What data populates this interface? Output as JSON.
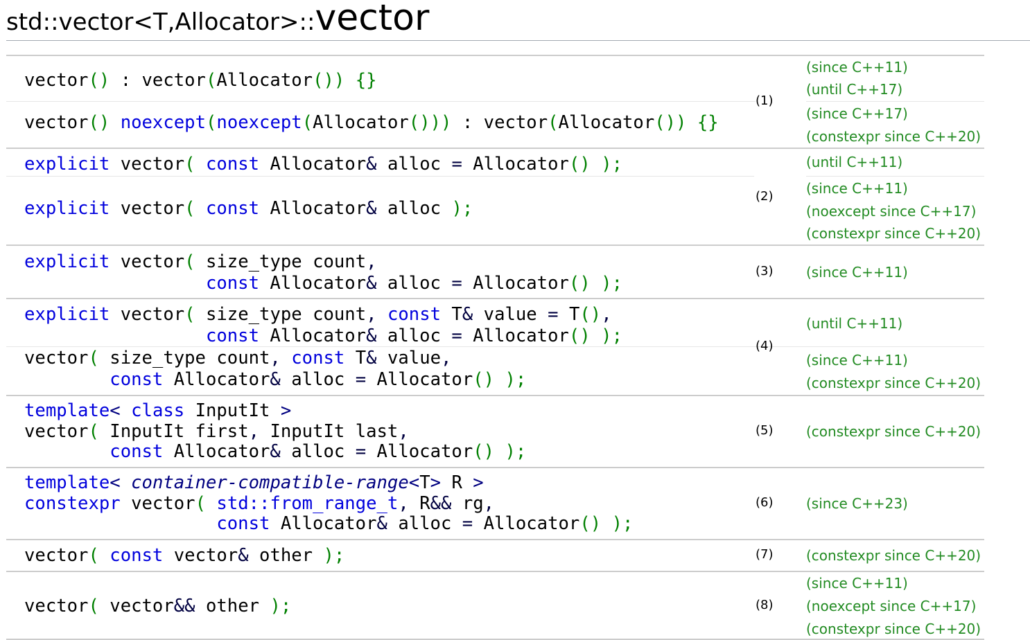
{
  "title": {
    "prefix": "std::vector<T,Allocator>::",
    "main": "vector"
  },
  "overloads": [
    {
      "number": "(1)",
      "variants": [
        {
          "code": [
            [
              [
                "vector",
                "co"
              ],
              [
                "()",
                "p"
              ],
              [
                " : ",
                "co"
              ],
              [
                "vector",
                "co"
              ],
              [
                "(",
                "p"
              ],
              [
                "Allocator",
                "co"
              ],
              [
                "())",
                "p"
              ],
              [
                " ",
                "co"
              ],
              [
                "{}",
                "p"
              ]
            ]
          ],
          "versions": [
            "(since C++11)",
            "(until C++17)"
          ]
        },
        {
          "code": [
            [
              [
                "vector",
                "co"
              ],
              [
                "()",
                "p"
              ],
              [
                " ",
                "co"
              ],
              [
                "noexcept",
                "kw"
              ],
              [
                "(",
                "p"
              ],
              [
                "noexcept",
                "kw"
              ],
              [
                "(",
                "p"
              ],
              [
                "Allocator",
                "co"
              ],
              [
                "()))",
                "p"
              ],
              [
                " : ",
                "co"
              ],
              [
                "vector",
                "co"
              ],
              [
                "(",
                "p"
              ],
              [
                "Allocator",
                "co"
              ],
              [
                "())",
                "p"
              ],
              [
                " ",
                "co"
              ],
              [
                "{}",
                "p"
              ]
            ]
          ],
          "versions": [
            "(since C++17)",
            "(constexpr since C++20)"
          ]
        }
      ]
    },
    {
      "number": "(2)",
      "variants": [
        {
          "code": [
            [
              [
                "explicit",
                "kw"
              ],
              [
                " vector",
                "co"
              ],
              [
                "(",
                "p"
              ],
              [
                " ",
                "co"
              ],
              [
                "const",
                "kw"
              ],
              [
                " Allocator",
                "co"
              ],
              [
                "&",
                "op"
              ],
              [
                " alloc ",
                "co"
              ],
              [
                "=",
                "op"
              ],
              [
                " Allocator",
                "co"
              ],
              [
                "()",
                "p"
              ],
              [
                " ",
                "co"
              ],
              [
                ");",
                "p"
              ]
            ]
          ],
          "versions": [
            "(until C++11)"
          ]
        },
        {
          "code": [
            [
              [
                "explicit",
                "kw"
              ],
              [
                " vector",
                "co"
              ],
              [
                "(",
                "p"
              ],
              [
                " ",
                "co"
              ],
              [
                "const",
                "kw"
              ],
              [
                " Allocator",
                "co"
              ],
              [
                "&",
                "op"
              ],
              [
                " alloc ",
                "co"
              ],
              [
                ");",
                "p"
              ]
            ]
          ],
          "versions": [
            "(since C++11)",
            "(noexcept since C++17)",
            "(constexpr since C++20)"
          ]
        }
      ]
    },
    {
      "number": "(3)",
      "variants": [
        {
          "code": [
            [
              [
                "explicit",
                "kw"
              ],
              [
                " vector",
                "co"
              ],
              [
                "(",
                "p"
              ],
              [
                " size_type count",
                "co"
              ],
              [
                ",",
                "op"
              ]
            ],
            [
              [
                "                 ",
                "co"
              ],
              [
                "const",
                "kw"
              ],
              [
                " Allocator",
                "co"
              ],
              [
                "&",
                "op"
              ],
              [
                " alloc ",
                "co"
              ],
              [
                "=",
                "op"
              ],
              [
                " Allocator",
                "co"
              ],
              [
                "()",
                "p"
              ],
              [
                " ",
                "co"
              ],
              [
                ");",
                "p"
              ]
            ]
          ],
          "versions": [
            "(since C++11)"
          ]
        }
      ]
    },
    {
      "number": "(4)",
      "variants": [
        {
          "code": [
            [
              [
                "explicit",
                "kw"
              ],
              [
                " vector",
                "co"
              ],
              [
                "(",
                "p"
              ],
              [
                " size_type count",
                "co"
              ],
              [
                ",",
                "op"
              ],
              [
                " ",
                "co"
              ],
              [
                "const",
                "kw"
              ],
              [
                " T",
                "co"
              ],
              [
                "&",
                "op"
              ],
              [
                " value ",
                "co"
              ],
              [
                "=",
                "op"
              ],
              [
                " T",
                "co"
              ],
              [
                "()",
                "p"
              ],
              [
                ",",
                "op"
              ]
            ],
            [
              [
                "                 ",
                "co"
              ],
              [
                "const",
                "kw"
              ],
              [
                " Allocator",
                "co"
              ],
              [
                "&",
                "op"
              ],
              [
                " alloc ",
                "co"
              ],
              [
                "=",
                "op"
              ],
              [
                " Allocator",
                "co"
              ],
              [
                "()",
                "p"
              ],
              [
                " ",
                "co"
              ],
              [
                ");",
                "p"
              ]
            ]
          ],
          "versions": [
            "(until C++11)"
          ]
        },
        {
          "code": [
            [
              [
                "vector",
                "co"
              ],
              [
                "(",
                "p"
              ],
              [
                " size_type count",
                "co"
              ],
              [
                ",",
                "op"
              ],
              [
                " ",
                "co"
              ],
              [
                "const",
                "kw"
              ],
              [
                " T",
                "co"
              ],
              [
                "&",
                "op"
              ],
              [
                " value",
                "co"
              ],
              [
                ",",
                "op"
              ]
            ],
            [
              [
                "        ",
                "co"
              ],
              [
                "const",
                "kw"
              ],
              [
                " Allocator",
                "co"
              ],
              [
                "&",
                "op"
              ],
              [
                " alloc ",
                "co"
              ],
              [
                "=",
                "op"
              ],
              [
                " Allocator",
                "co"
              ],
              [
                "()",
                "p"
              ],
              [
                " ",
                "co"
              ],
              [
                ");",
                "p"
              ]
            ]
          ],
          "versions": [
            "(since C++11)",
            "(constexpr since C++20)"
          ]
        }
      ]
    },
    {
      "number": "(5)",
      "variants": [
        {
          "code": [
            [
              [
                "template",
                "kw"
              ],
              [
                "<",
                "sy"
              ],
              [
                " ",
                "co"
              ],
              [
                "class",
                "kw"
              ],
              [
                " InputIt ",
                "co"
              ],
              [
                ">",
                "sy"
              ]
            ],
            [
              [
                "vector",
                "co"
              ],
              [
                "(",
                "p"
              ],
              [
                " InputIt first",
                "co"
              ],
              [
                ",",
                "op"
              ],
              [
                " InputIt last",
                "co"
              ],
              [
                ",",
                "op"
              ]
            ],
            [
              [
                "        ",
                "co"
              ],
              [
                "const",
                "kw"
              ],
              [
                " Allocator",
                "co"
              ],
              [
                "&",
                "op"
              ],
              [
                " alloc ",
                "co"
              ],
              [
                "=",
                "op"
              ],
              [
                " Allocator",
                "co"
              ],
              [
                "()",
                "p"
              ],
              [
                " ",
                "co"
              ],
              [
                ");",
                "p"
              ]
            ]
          ],
          "versions": [
            "(constexpr since C++20)"
          ]
        }
      ]
    },
    {
      "number": "(6)",
      "variants": [
        {
          "code": [
            [
              [
                "template",
                "kw"
              ],
              [
                "<",
                "sy"
              ],
              [
                " ",
                "co"
              ],
              [
                "container-compatible-range",
                "it"
              ],
              [
                "<",
                "sy"
              ],
              [
                "T",
                "co"
              ],
              [
                ">",
                "sy"
              ],
              [
                " R ",
                "co"
              ],
              [
                ">",
                "sy"
              ]
            ],
            [
              [
                "constexpr",
                "kw"
              ],
              [
                " vector",
                "co"
              ],
              [
                "(",
                "p"
              ],
              [
                " ",
                "co"
              ],
              [
                "std::from_range_t",
                "kw"
              ],
              [
                ",",
                "op"
              ],
              [
                " R",
                "co"
              ],
              [
                "&&",
                "op"
              ],
              [
                " rg",
                "co"
              ],
              [
                ",",
                "op"
              ]
            ],
            [
              [
                "                  ",
                "co"
              ],
              [
                "const",
                "kw"
              ],
              [
                " Allocator",
                "co"
              ],
              [
                "&",
                "op"
              ],
              [
                " alloc ",
                "co"
              ],
              [
                "=",
                "op"
              ],
              [
                " Allocator",
                "co"
              ],
              [
                "()",
                "p"
              ],
              [
                " ",
                "co"
              ],
              [
                ");",
                "p"
              ]
            ]
          ],
          "versions": [
            "(since C++23)"
          ]
        }
      ]
    },
    {
      "number": "(7)",
      "variants": [
        {
          "code": [
            [
              [
                "vector",
                "co"
              ],
              [
                "(",
                "p"
              ],
              [
                " ",
                "co"
              ],
              [
                "const",
                "kw"
              ],
              [
                " vector",
                "co"
              ],
              [
                "&",
                "op"
              ],
              [
                " other ",
                "co"
              ],
              [
                ");",
                "p"
              ]
            ]
          ],
          "versions": [
            "(constexpr since C++20)"
          ]
        }
      ]
    },
    {
      "number": "(8)",
      "variants": [
        {
          "code": [
            [
              [
                "vector",
                "co"
              ],
              [
                "(",
                "p"
              ],
              [
                " vector",
                "co"
              ],
              [
                "&&",
                "op"
              ],
              [
                " other ",
                "co"
              ],
              [
                ");",
                "p"
              ]
            ]
          ],
          "versions": [
            "(since C++11)",
            "(noexcept since C++17)",
            "(constexpr since C++20)"
          ]
        }
      ]
    }
  ],
  "colors": {
    "keyword": "#0000dd",
    "bracket": "#008000",
    "symbol": "#000080",
    "version": "#228b22",
    "rule": "#cccccc"
  }
}
